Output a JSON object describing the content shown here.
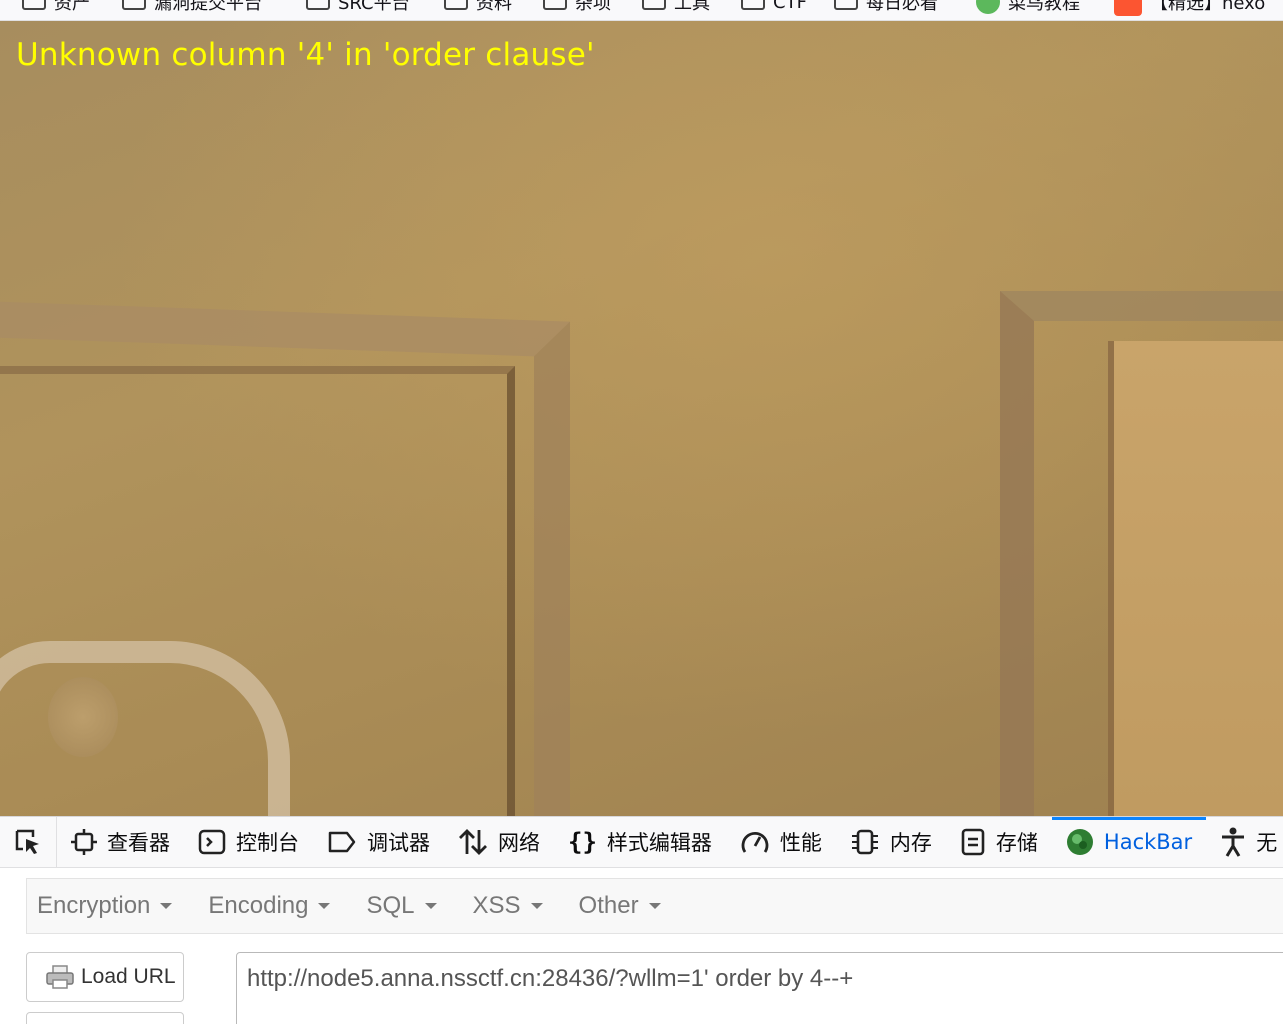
{
  "bookmarks": [
    {
      "label": "资产",
      "icon": "folder-icon"
    },
    {
      "label": "漏洞提交平台",
      "icon": "folder-icon"
    },
    {
      "label": "SRC平台",
      "icon": "folder-icon"
    },
    {
      "label": "资料",
      "icon": "folder-icon"
    },
    {
      "label": "杂项",
      "icon": "folder-icon"
    },
    {
      "label": "工具",
      "icon": "folder-icon"
    },
    {
      "label": "CTF",
      "icon": "folder-icon"
    },
    {
      "label": "每日必看",
      "icon": "folder-icon"
    },
    {
      "label": "菜鸟教程",
      "icon": "runoob-icon"
    },
    {
      "label": "【精选】hexo",
      "icon": "csdn-icon"
    }
  ],
  "page": {
    "error_message": "Unknown column '4' in 'order clause'"
  },
  "devtools": {
    "tabs": [
      {
        "label": "查看器",
        "icon": "inspector-icon"
      },
      {
        "label": "控制台",
        "icon": "console-icon"
      },
      {
        "label": "调试器",
        "icon": "debugger-icon"
      },
      {
        "label": "网络",
        "icon": "network-icon"
      },
      {
        "label": "样式编辑器",
        "icon": "style-editor-icon"
      },
      {
        "label": "性能",
        "icon": "performance-icon"
      },
      {
        "label": "内存",
        "icon": "memory-icon"
      },
      {
        "label": "存储",
        "icon": "storage-icon"
      },
      {
        "label": "HackBar",
        "icon": "hackbar-icon",
        "active": true
      },
      {
        "label": "无",
        "icon": "accessibility-icon"
      }
    ],
    "accent_color": "#0a84ff"
  },
  "hackbar": {
    "menus": [
      "Encryption",
      "Encoding",
      "SQL",
      "XSS",
      "Other"
    ],
    "load_url_label": "Load URL",
    "url_value": "http://node5.anna.nssctf.cn:28436/?wllm=1' order by 4--+"
  },
  "colors": {
    "error_text": "#ffff00",
    "active_tab": "#0060df"
  }
}
